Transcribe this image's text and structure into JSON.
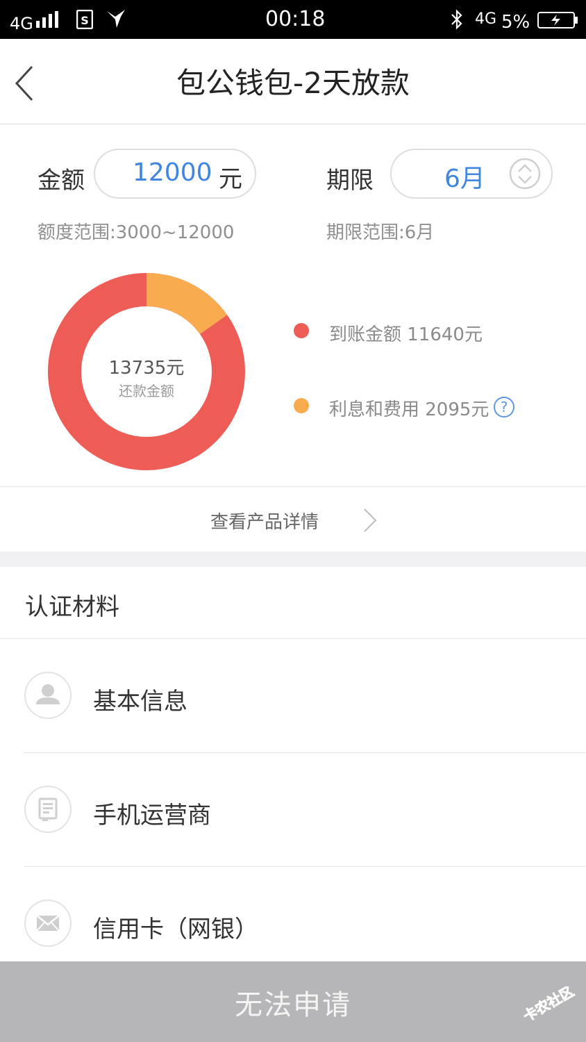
{
  "status_bar": {
    "network": "4G",
    "time": "00:18",
    "network_right": "4G",
    "battery": "5%"
  },
  "header": {
    "title": "包公钱包-2天放款"
  },
  "loan": {
    "amount_label": "金额",
    "amount_value": "12000",
    "amount_unit": "元",
    "amount_range": "额度范围:3000~12000",
    "term_label": "期限",
    "term_value": "6月",
    "term_range": "期限范围:6月"
  },
  "donut": {
    "center_value": "13735元",
    "center_label": "还款金额",
    "received_legend": "到账金额 11640元",
    "fee_legend": "利息和费用 2095元",
    "received_color": "#ee5c56",
    "fee_color": "#f8ac4f",
    "received_amount": 11640,
    "fee_amount": 2095
  },
  "details_link": "查看产品详情",
  "auth": {
    "section_title": "认证材料",
    "items": [
      {
        "label": "基本信息",
        "icon": "person-icon"
      },
      {
        "label": "手机运营商",
        "icon": "phone-carrier-icon"
      },
      {
        "label": "信用卡（网银）",
        "icon": "envelope-icon"
      }
    ]
  },
  "apply_button": "无法申请",
  "watermark": "卡农社区"
}
